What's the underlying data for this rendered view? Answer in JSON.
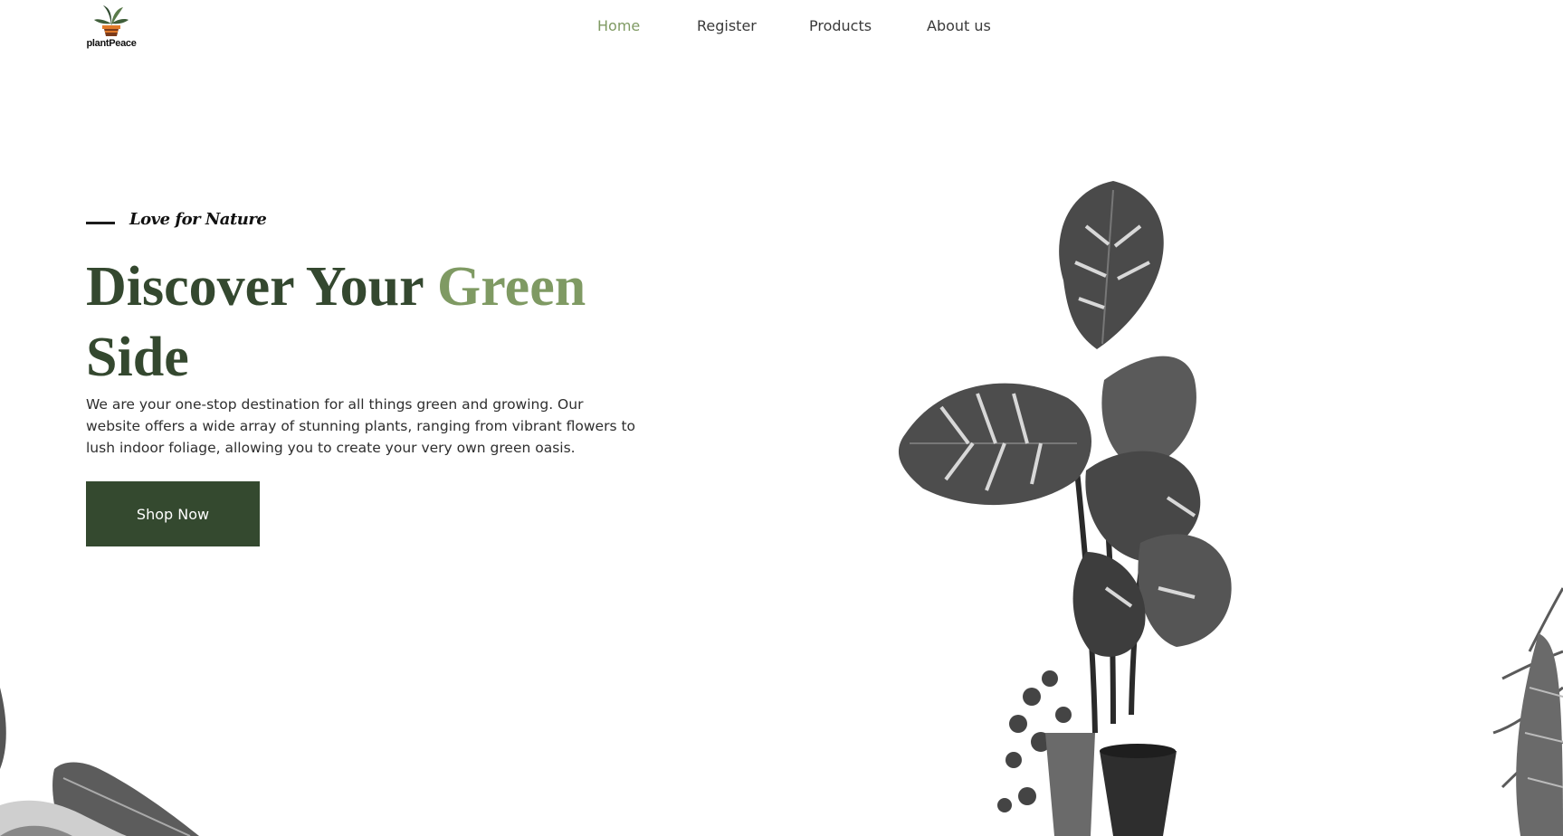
{
  "brand": {
    "logo_text": "plantPeace",
    "logo_icon": "potted-plant-icon",
    "colors": {
      "primary": "#34492f",
      "accent": "#7f9a63"
    }
  },
  "nav": {
    "items": [
      {
        "label": "Home",
        "active": true
      },
      {
        "label": "Register",
        "active": false
      },
      {
        "label": "Products",
        "active": false
      },
      {
        "label": "About us",
        "active": false
      }
    ]
  },
  "hero": {
    "tagline": "Love for Nature",
    "title_part1": "Discover Your ",
    "title_accent": "Green",
    "title_part2": "Side",
    "description": "We are your one-stop destination for all things green and growing. Our website offers a wide array of stunning plants, ranging from vibrant flowers to lush indoor foliage, allowing you to create your very own green oasis.",
    "cta_label": "Shop Now"
  },
  "images": {
    "main": "monstera-plant-image",
    "bottom_left": "leaf-image",
    "bottom_right": "fern-image"
  }
}
